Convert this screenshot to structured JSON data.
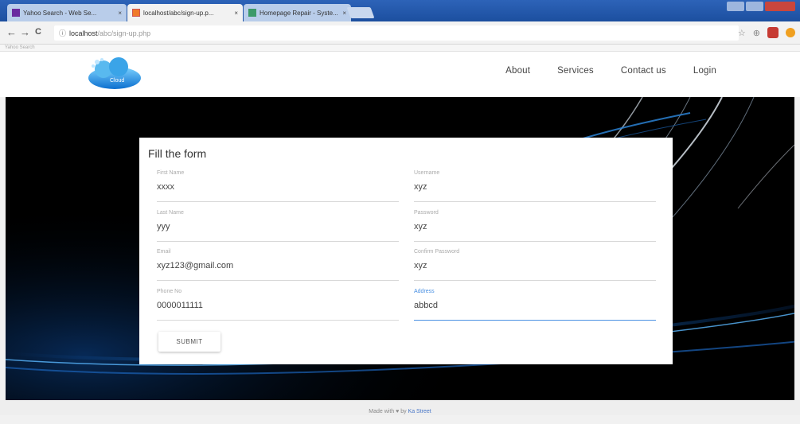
{
  "browser": {
    "tabs": [
      {
        "title": "Yahoo Search - Web Se...",
        "active": false
      },
      {
        "title": "localhost/abc/sign-up.p...",
        "active": true
      },
      {
        "title": "Homepage Repair - Syste...",
        "active": false
      }
    ],
    "tab_close_glyph": "×",
    "url_host": "localhost",
    "url_path": "/abc/sign-up.php",
    "nav": {
      "back": "←",
      "forward": "→",
      "reload": "C",
      "info": "ⓘ"
    },
    "icons": {
      "star": "☆",
      "ext": "⊕"
    },
    "bookmarks_text": "Yahoo Search"
  },
  "site": {
    "logo_text": "Cloud",
    "nav": [
      "About",
      "Services",
      "Contact us",
      "Login"
    ]
  },
  "form": {
    "title": "Fill the form",
    "left_fields": [
      {
        "label": "First Name",
        "value": "xxxx"
      },
      {
        "label": "Last Name",
        "value": "yyy"
      },
      {
        "label": "Email",
        "value": "xyz123@gmail.com"
      },
      {
        "label": "Phone No",
        "value": "0000011111"
      }
    ],
    "right_fields": [
      {
        "label": "Username",
        "value": "xyz"
      },
      {
        "label": "Password",
        "value": "xyz"
      },
      {
        "label": "Confirm Password",
        "value": "xyz"
      },
      {
        "label": "Address",
        "value": "abbcd"
      }
    ],
    "submit_label": "SUBMIT"
  },
  "footer": {
    "text": "Made with ♥ by",
    "link": "Ka Street"
  },
  "colors": {
    "accent": "#4a90e2",
    "hero": "#000000",
    "beam": "#1e7fd8"
  }
}
